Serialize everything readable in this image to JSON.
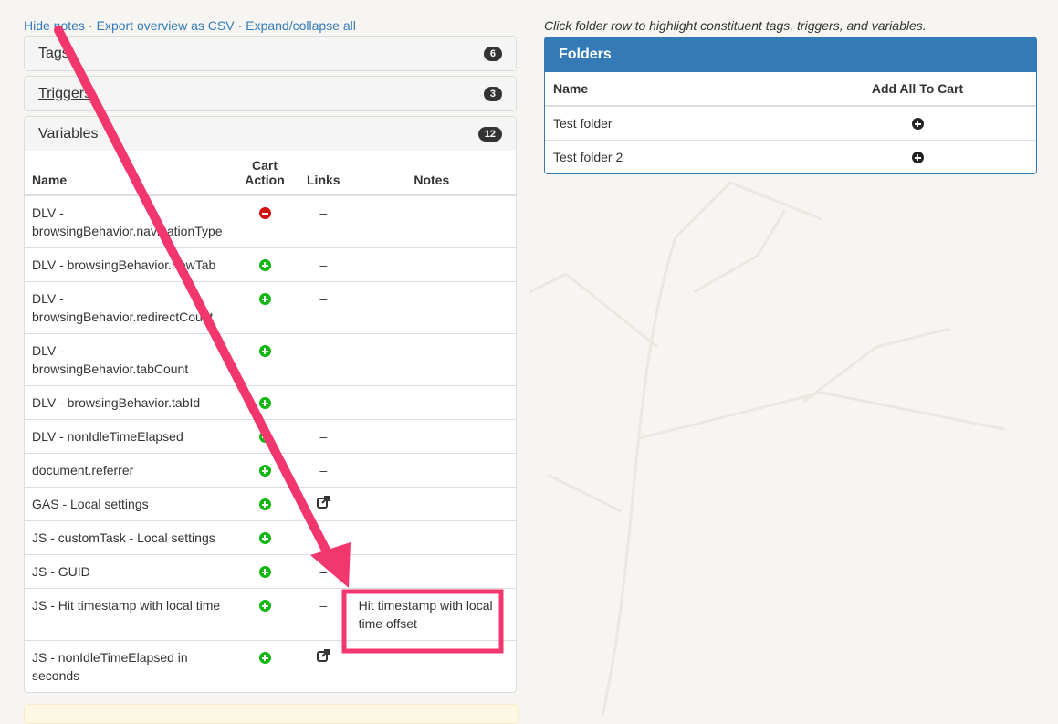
{
  "links": {
    "hide_notes": "Hide notes",
    "export_csv": "Export overview as CSV",
    "expand": "Expand/collapse all",
    "sep": "·"
  },
  "panels": {
    "tags": {
      "title": "Tags",
      "count": "6"
    },
    "triggers": {
      "title": "Triggers",
      "count": "3"
    },
    "variables": {
      "title": "Variables",
      "count": "12"
    }
  },
  "vars_table": {
    "headers": {
      "name": "Name",
      "cart_line1": "Cart",
      "cart_line2": "Action",
      "links": "Links",
      "notes": "Notes"
    },
    "rows": [
      {
        "name": "DLV - browsingBehavior.navigationType",
        "action": "remove",
        "link": "–",
        "note": ""
      },
      {
        "name": "DLV - browsingBehavior.newTab",
        "action": "add",
        "link": "–",
        "note": ""
      },
      {
        "name": "DLV - browsingBehavior.redirectCount",
        "action": "add",
        "link": "–",
        "note": ""
      },
      {
        "name": "DLV - browsingBehavior.tabCount",
        "action": "add",
        "link": "–",
        "note": ""
      },
      {
        "name": "DLV - browsingBehavior.tabId",
        "action": "add",
        "link": "–",
        "note": ""
      },
      {
        "name": "DLV - nonIdleTimeElapsed",
        "action": "add",
        "link": "–",
        "note": ""
      },
      {
        "name": "document.referrer",
        "action": "add",
        "link": "–",
        "note": ""
      },
      {
        "name": "GAS - Local settings",
        "action": "add",
        "link": "external",
        "note": ""
      },
      {
        "name": "JS - customTask - Local settings",
        "action": "add",
        "link": "",
        "note": ""
      },
      {
        "name": "JS - GUID",
        "action": "add",
        "link": "–",
        "note": ""
      },
      {
        "name": "JS - Hit timestamp with local time",
        "action": "add",
        "link": "–",
        "note": "Hit timestamp with local time offset"
      },
      {
        "name": "JS - nonIdleTimeElapsed in seconds",
        "action": "add",
        "link": "external",
        "note": ""
      }
    ]
  },
  "folders": {
    "hint": "Click folder row to highlight constituent tags, triggers, and variables.",
    "title": "Folders",
    "headers": {
      "name": "Name",
      "add": "Add All To Cart"
    },
    "rows": [
      {
        "name": "Test folder"
      },
      {
        "name": "Test folder 2"
      }
    ]
  },
  "annotation": {
    "color": "#f2376f"
  }
}
